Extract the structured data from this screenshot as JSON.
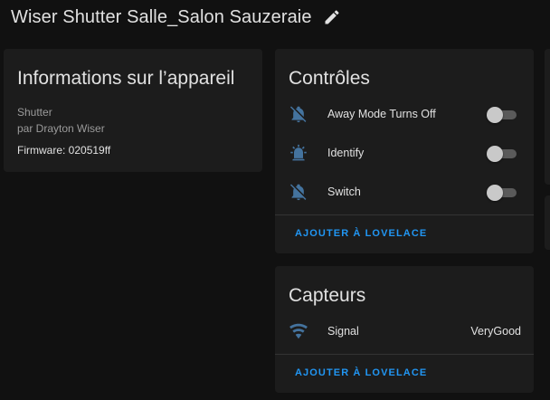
{
  "page": {
    "title": "Wiser Shutter Salle_Salon Sauzeraie"
  },
  "colors": {
    "background": "#111111",
    "card": "#1c1c1c",
    "accent": "#2196f3",
    "icon": "#44739e",
    "text_primary": "#e1e1e1",
    "text_secondary": "#9b9b9b"
  },
  "info_card": {
    "title": "Informations sur l’appareil",
    "model": "Shutter",
    "manufacturer": "par Drayton Wiser",
    "firmware": "Firmware: 020519ff"
  },
  "controls_card": {
    "title": "Contrôles",
    "items": [
      {
        "label": "Away Mode Turns Off",
        "icon": "bell-off-icon",
        "state": "off"
      },
      {
        "label": "Identify",
        "icon": "alarm-light-icon",
        "state": "off"
      },
      {
        "label": "Switch",
        "icon": "bell-off-icon",
        "state": "off"
      }
    ],
    "action": "AJOUTER À LOVELACE"
  },
  "sensors_card": {
    "title": "Capteurs",
    "items": [
      {
        "label": "Signal",
        "icon": "wifi-icon",
        "value": "VeryGood"
      }
    ],
    "action": "AJOUTER À LOVELACE"
  }
}
